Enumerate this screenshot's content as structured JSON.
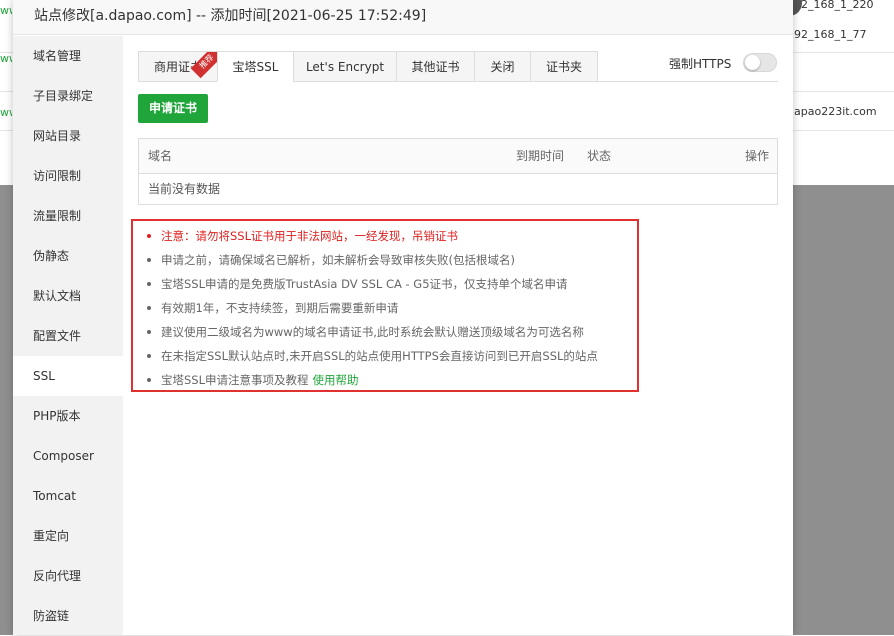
{
  "background": {
    "right_items": [
      "92_168_1_220",
      "92_168_1_77",
      "apao223it.com"
    ]
  },
  "modal": {
    "title": "站点修改[a.dapao.com] -- 添加时间[2021-06-25 17:52:49]"
  },
  "sidebar": {
    "items": [
      {
        "label": "域名管理"
      },
      {
        "label": "子目录绑定"
      },
      {
        "label": "网站目录"
      },
      {
        "label": "访问限制"
      },
      {
        "label": "流量限制"
      },
      {
        "label": "伪静态"
      },
      {
        "label": "默认文档"
      },
      {
        "label": "配置文件"
      },
      {
        "label": "SSL"
      },
      {
        "label": "PHP版本"
      },
      {
        "label": "Composer"
      },
      {
        "label": "Tomcat"
      },
      {
        "label": "重定向"
      },
      {
        "label": "反向代理"
      },
      {
        "label": "防盗链"
      }
    ],
    "active_index": 8
  },
  "tabs": [
    {
      "label": "商用证书",
      "badge": "推荐"
    },
    {
      "label": "宝塔SSL"
    },
    {
      "label": "Let's Encrypt"
    },
    {
      "label": "其他证书"
    },
    {
      "label": "关闭"
    },
    {
      "label": "证书夹"
    }
  ],
  "active_tab": 1,
  "force_https": {
    "label": "强制HTTPS",
    "enabled": false
  },
  "apply_button": "申请证书",
  "table": {
    "columns": [
      "域名",
      "到期时间",
      "状态",
      "操作"
    ],
    "empty_text": "当前没有数据"
  },
  "notes": [
    "注意：请勿将SSL证书用于非法网站，一经发现，吊销证书",
    "申请之前，请确保域名已解析，如未解析会导致审核失败(包括根域名)",
    "宝塔SSL申请的是免费版TrustAsia DV SSL CA - G5证书，仅支持单个域名申请",
    "有效期1年，不支持续签，到期后需要重新申请",
    "建议使用二级域名为www的域名申请证书,此时系统会默认赠送顶级域名为可选名称",
    "在未指定SSL默认站点时,未开启SSL的站点使用HTTPS会直接访问到已开启SSL的站点",
    "宝塔SSL申请注意事项及教程"
  ],
  "help_link": "使用帮助",
  "colors": {
    "accent": "#20a53a",
    "warning": "#e02020",
    "highlight_border": "#e03030"
  }
}
